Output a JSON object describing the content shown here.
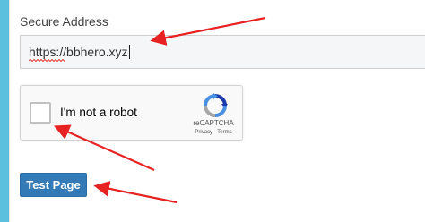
{
  "form": {
    "label": "Secure Address",
    "input_value_prefix": "https",
    "input_value_rest": "://bbhero.xyz"
  },
  "captcha": {
    "label": "I'm not a robot",
    "brand": "reCAPTCHA",
    "links": "Privacy - Terms",
    "logo_icon": "recaptcha-logo"
  },
  "button": {
    "label": "Test Page"
  },
  "colors": {
    "accent_bar": "#5bc0de",
    "button": "#337ab7",
    "annotation_arrow": "#e62222"
  }
}
